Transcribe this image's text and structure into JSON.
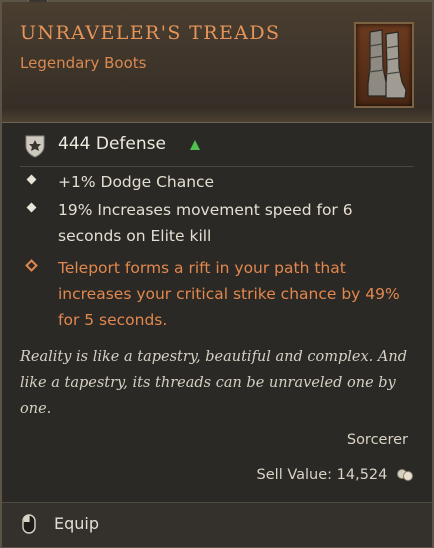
{
  "item": {
    "name": "UNRAVELER'S TREADS",
    "type": "Legendary Boots",
    "icon": "boots-icon",
    "rarity_color": "#e6955a"
  },
  "defense": {
    "text": "444 Defense",
    "indicator": "up-arrow-icon",
    "indicator_color": "#4fbf4f"
  },
  "affixes": [
    {
      "text": "+1% Dodge Chance",
      "legendary": false
    },
    {
      "text": "19% Increases movement speed for 6 seconds on Elite kill",
      "legendary": false
    },
    {
      "text": "Teleport forms a rift in your path that increases your critical strike chance by 49% for 5 seconds.",
      "legendary": true
    }
  ],
  "flavor": "Reality is like a tapestry, beautiful and complex. And like a tapestry, its threads can be unraveled one by one.",
  "class_requirement": "Sorcerer",
  "sell_value": {
    "label": "Sell Value: 14,524",
    "icon": "gold-icon"
  },
  "actions": {
    "equip_label": "Equip",
    "equip_icon": "mouse-icon"
  },
  "colors": {
    "legendary_orange": "#e2874e",
    "background": "#2b2925",
    "text": "#e4ded2"
  }
}
